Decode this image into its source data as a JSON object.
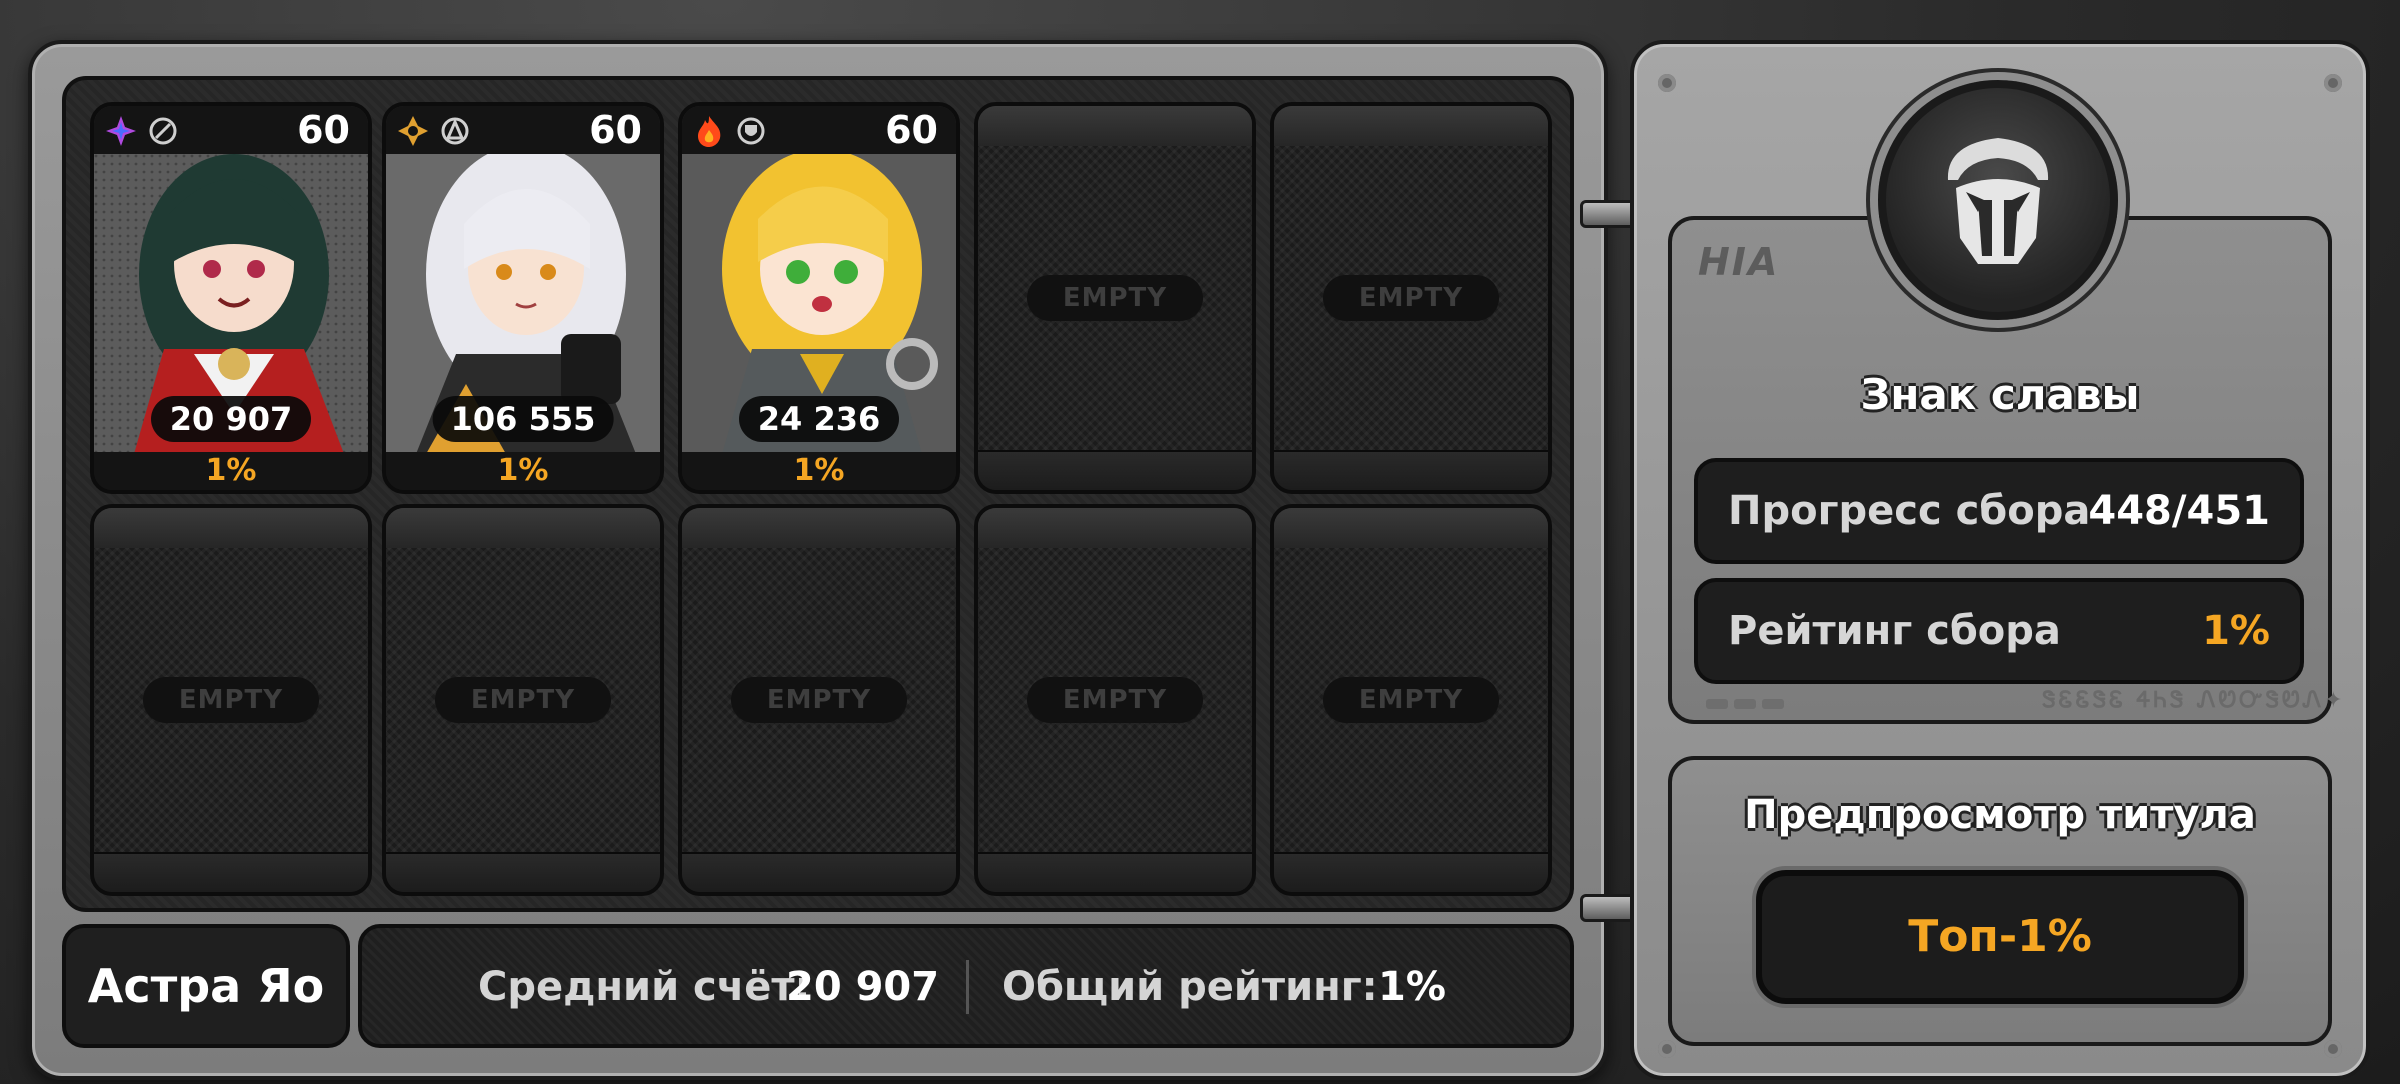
{
  "characters": [
    {
      "level": "60",
      "score": "20 907",
      "percent": "1%",
      "element": "ether-icon",
      "spec": "support-icon",
      "accent": "#c0392b"
    },
    {
      "level": "60",
      "score": "106 555",
      "percent": "1%",
      "element": "physical-icon",
      "spec": "attack-icon",
      "accent": "#e0a030"
    },
    {
      "level": "60",
      "score": "24 236",
      "percent": "1%",
      "element": "fire-icon",
      "spec": "defense-icon",
      "accent": "#f2c230"
    }
  ],
  "empty_label": "EMPTY",
  "player": {
    "name": "Астра Яо",
    "avg_score_label": "Средний счёт:",
    "avg_score_value": "20 907",
    "overall_rank_label": "Общий рейтинг:",
    "overall_rank_value": "1%"
  },
  "badge": {
    "name": "Знак славы",
    "progress_label": "Прогресс сбора",
    "progress_value": "448/451",
    "rank_label": "Рейтинг сбора",
    "rank_value": "1%",
    "logo_text": "HIA",
    "deco_text": "ᏕᏋᏋᏕᏋ ᏎᏂᏕ ᏁᏬᏅᏕᏬᏁ✦"
  },
  "title_preview": {
    "heading": "Предпросмотр титула",
    "value": "Топ-1%"
  },
  "colors": {
    "accent_orange": "#f5a623"
  }
}
